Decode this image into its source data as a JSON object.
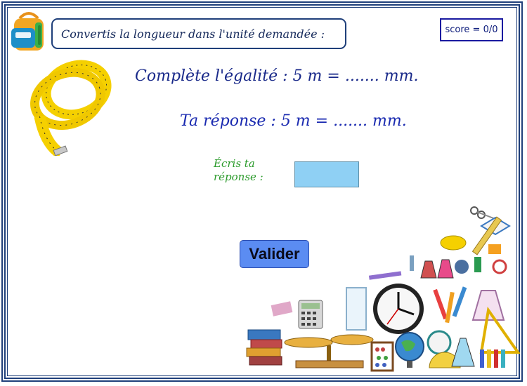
{
  "header": {
    "instruction": "Convertis la longueur dans l'unité demandée :"
  },
  "score": {
    "text": "score = 0/0"
  },
  "question": {
    "text": "Complète l'égalité : 5 m = ....... mm."
  },
  "answer_line": {
    "text": "Ta réponse :  5 m = ....... mm."
  },
  "answer_input": {
    "label_line1": "Écris ta",
    "label_line2": "réponse :",
    "value": ""
  },
  "submit": {
    "label": "Valider"
  },
  "colors": {
    "frame": "#1f3f7a",
    "question_text": "#1a2a8a",
    "label_green": "#2a9a2a",
    "input_fill": "#8fd0f4",
    "button_fill": "#5b8cf2"
  },
  "icons": {
    "backpack": "backpack-icon",
    "tape_measure": "tape-measure-image",
    "supplies": "school-supplies-image"
  }
}
